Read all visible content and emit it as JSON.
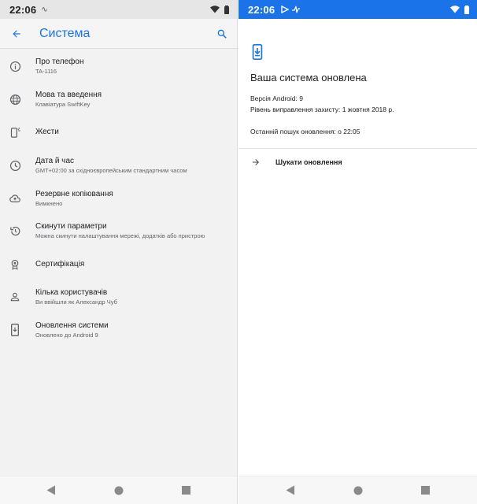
{
  "left": {
    "status_bar": {
      "time": "22:06",
      "mini_indicator": "∿"
    },
    "app_bar": {
      "title": "Система",
      "back_icon": "arrow-left-icon",
      "search_icon": "search-icon"
    },
    "items": [
      {
        "icon": "info-icon",
        "title": "Про телефон",
        "subtitle": "TA-1116"
      },
      {
        "icon": "globe-icon",
        "title": "Мова та введення",
        "subtitle": "Клавіатура SwiftKey"
      },
      {
        "icon": "gesture-phone-icon",
        "title": "Жести",
        "subtitle": ""
      },
      {
        "icon": "clock-icon",
        "title": "Дата й час",
        "subtitle": "GMT+02:00 за східноєвропейським стандартним часом"
      },
      {
        "icon": "cloud-upload-icon",
        "title": "Резервне копіювання",
        "subtitle": "Вимкнено"
      },
      {
        "icon": "history-icon",
        "title": "Скинути параметри",
        "subtitle": "Можна скинути налаштування мережі, додатків або пристрою"
      },
      {
        "icon": "certificate-icon",
        "title": "Сертифікація",
        "subtitle": ""
      },
      {
        "icon": "person-icon",
        "title": "Кілька користувачів",
        "subtitle": "Ви ввійшли як Александр Чуб"
      },
      {
        "icon": "system-update-icon",
        "title": "Оновлення системи",
        "subtitle": "Оновлено до Android 9"
      }
    ]
  },
  "right": {
    "status_bar": {
      "time": "22:06"
    },
    "update": {
      "heading": "Ваша система оновлена",
      "android_version": "Версія Android: 9",
      "security_patch": "Рівень виправлення захисту: 1 жовтня 2018 р.",
      "last_check": "Останній пошук оновлення: о 22:05",
      "check_button": "Шукати оновлення"
    }
  },
  "colors": {
    "accent": "#1a73e8",
    "icon_gray": "#5f6368"
  }
}
